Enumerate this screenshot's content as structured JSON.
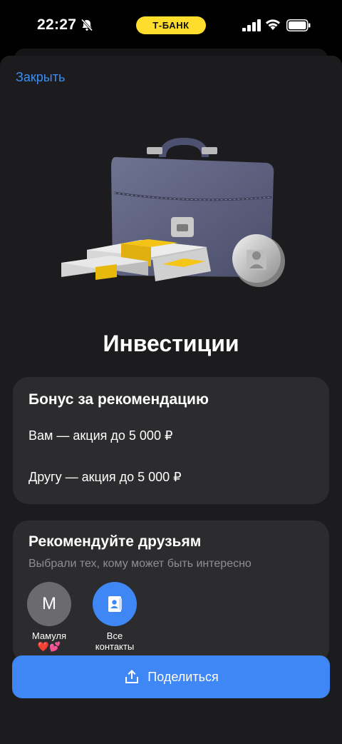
{
  "status_bar": {
    "time": "22:27",
    "carrier": "Т-БАНК",
    "icons": [
      "bell-slash-icon",
      "signal-icon",
      "wifi-icon",
      "battery-icon"
    ]
  },
  "colors": {
    "accent": "#3f87f5",
    "link": "#3d8cf0",
    "brand_yellow": "#ffdd2d",
    "sheet_bg": "#1c1c1e",
    "card_bg": "#2c2c2e"
  },
  "header": {
    "close_label": "Закрыть"
  },
  "hero": {
    "icon": "briefcase-with-money-icon"
  },
  "page": {
    "title": "Инвестиции"
  },
  "bonus_card": {
    "title": "Бонус за рекомендацию",
    "lines": [
      "Вам — акция до 5 000 ₽",
      "Другу — акция до 5 000 ₽"
    ]
  },
  "friends_card": {
    "title": "Рекомендуйте друзьям",
    "subtitle": "Выбрали тех, кому может быть интересно",
    "contacts": [
      {
        "initial": "М",
        "name": "Мамуля",
        "emoji": "❤️💕"
      },
      {
        "icon": "contacts-book-icon",
        "name_line1": "Все",
        "name_line2": "контакты"
      }
    ]
  },
  "share_button": {
    "label": "Поделиться",
    "icon": "share-upload-icon"
  }
}
